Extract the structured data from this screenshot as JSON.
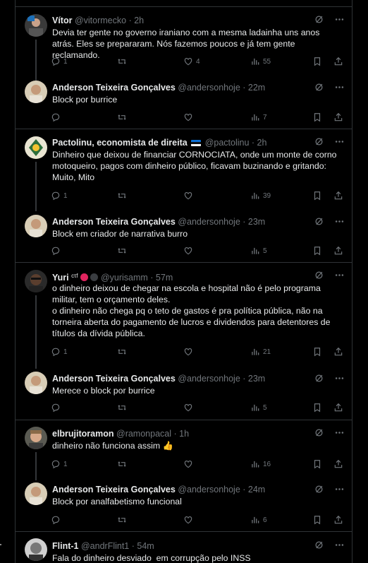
{
  "tweets": [
    {
      "name": "Vítor",
      "handle": "@vitormecko",
      "time": "· 2h",
      "text": "Devia ter gente no governo iraniano com a mesma ladainha uns anos atrás. Eles se prepararam. Nós fazemos poucos e já tem gente reclamando.",
      "replies": "1",
      "retweets": "",
      "likes": "4",
      "views": "55"
    },
    {
      "name": "Anderson Teixeira Gonçalves",
      "handle": "@andersonhoje",
      "time": "· 22m",
      "text": "Block por burrice",
      "replies": "",
      "retweets": "",
      "likes": "",
      "views": "7"
    },
    {
      "name": "Pactolinu, economista de direita",
      "handle": "@pactolinu",
      "time": "· 2h",
      "text": "Dinheiro que deixou de financiar CORNOCIATA, onde um monte de corno motoqueiro, pagos com dinheiro público, ficavam buzinando e gritando: Muito, Mito",
      "replies": "1",
      "retweets": "",
      "likes": "",
      "views": "39"
    },
    {
      "name": "Anderson Teixeira Gonçalves",
      "handle": "@andersonhoje",
      "time": "· 23m",
      "text": "Block em criador de narrativa burro",
      "replies": "",
      "retweets": "",
      "likes": "",
      "views": "5"
    },
    {
      "name": "Yuri",
      "handle": "@yurisamm",
      "time": "· 57m",
      "text": "o dinheiro deixou de chegar na escola e hospital não é pelo programa militar, tem o orçamento deles.\no dinheiro não chega pq o teto de gastos é pra política pública, não na torneira aberta do pagamento de lucros e dividendos para detentores de títulos da dívida pública.",
      "replies": "1",
      "retweets": "",
      "likes": "",
      "views": "21"
    },
    {
      "name": "Anderson Teixeira Gonçalves",
      "handle": "@andersonhoje",
      "time": "· 23m",
      "text": "Merece o block por burrice",
      "replies": "",
      "retweets": "",
      "likes": "",
      "views": "5"
    },
    {
      "name": "elbrujitoramon",
      "handle": "@ramonpacal",
      "time": "· 1h",
      "text": "dinheiro não funciona assim 👍",
      "replies": "1",
      "retweets": "",
      "likes": "",
      "views": "16"
    },
    {
      "name": "Anderson Teixeira Gonçalves",
      "handle": "@andersonhoje",
      "time": "· 24m",
      "text": "Block por analfabetismo funcional",
      "replies": "",
      "retweets": "",
      "likes": "",
      "views": "6"
    },
    {
      "name": "Flint-1",
      "handle": "@andrFlint1",
      "time": "· 54m",
      "text": "Fala do dinheiro desviado  em corrupção pelo INSS"
    }
  ],
  "yuri_badge": "cτf",
  "colors": {
    "background": "#000000",
    "text": "#e7e9ea",
    "muted": "#71767b",
    "border": "#2f3336"
  },
  "icons": [
    "reply-icon",
    "retweet-icon",
    "like-icon",
    "views-icon",
    "bookmark-icon",
    "share-icon",
    "grok-icon",
    "more-icon"
  ]
}
